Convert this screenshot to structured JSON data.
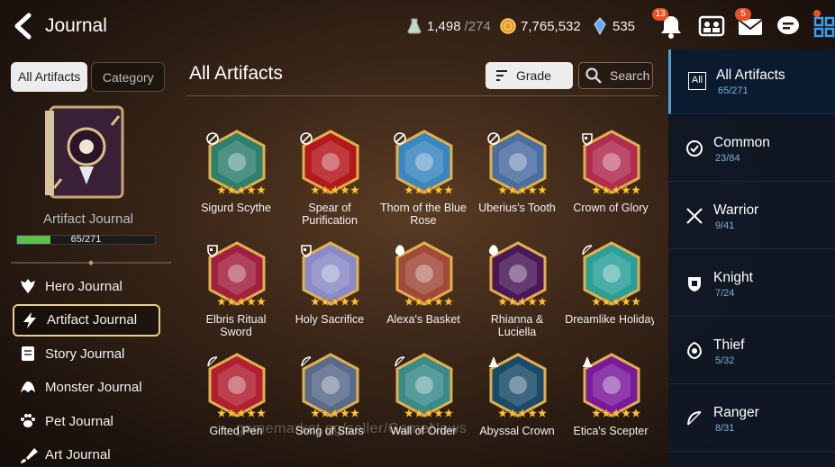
{
  "header": {
    "title": "Journal",
    "resources": [
      {
        "icon": "stamina-flask-icon",
        "value": "1,498",
        "sub": "/274"
      },
      {
        "icon": "gold-coin-icon",
        "value": "7,765,532",
        "sub": ""
      },
      {
        "icon": "skystone-gem-icon",
        "value": "535",
        "sub": ""
      }
    ],
    "notification_badge": "13",
    "mail_badge": "5"
  },
  "left_panel": {
    "tabs": [
      {
        "label": "All Artifacts",
        "active": true
      },
      {
        "label": "Category",
        "active": false
      }
    ],
    "journal_label": "Artifact Journal",
    "progress": {
      "text": "65/271",
      "fraction": 0.24
    },
    "nav": [
      {
        "label": "Hero Journal",
        "icon": "hero-icon",
        "active": false
      },
      {
        "label": "Artifact Journal",
        "icon": "lightning-icon",
        "active": true
      },
      {
        "label": "Story Journal",
        "icon": "scroll-icon",
        "active": false
      },
      {
        "label": "Monster Journal",
        "icon": "monster-icon",
        "active": false
      },
      {
        "label": "Pet Journal",
        "icon": "paw-icon",
        "active": false
      },
      {
        "label": "Art Journal",
        "icon": "brush-icon",
        "active": false
      }
    ]
  },
  "main": {
    "title": "All Artifacts",
    "grade_label": "Grade",
    "search_label": "Search",
    "artifacts": [
      {
        "name": "Sigurd Scythe",
        "class_icon": "warrior-icon",
        "color": "#2e7f6e"
      },
      {
        "name": "Spear of Purification",
        "class_icon": "warrior-icon",
        "color": "#b3181c"
      },
      {
        "name": "Thorn of the Blue Rose",
        "class_icon": "warrior-icon",
        "color": "#3a86c0"
      },
      {
        "name": "Uberius's Tooth",
        "class_icon": "warrior-icon",
        "color": "#4a6ea0"
      },
      {
        "name": "Crown of Glory",
        "class_icon": "knight-icon",
        "color": "#b02c50"
      },
      {
        "name": "Elbris Ritual Sword",
        "class_icon": "knight-icon",
        "color": "#a02040"
      },
      {
        "name": "Holy Sacrifice",
        "class_icon": "knight-icon",
        "color": "#8a8ac8"
      },
      {
        "name": "Alexa's Basket",
        "class_icon": "thief-icon",
        "color": "#a04a3a"
      },
      {
        "name": "Rhianna & Luciella",
        "class_icon": "thief-icon",
        "color": "#4a1858"
      },
      {
        "name": "Dreamlike Holiday",
        "class_icon": "ranger-icon",
        "color": "#2aa098"
      },
      {
        "name": "Gifted Pen",
        "class_icon": "ranger-icon",
        "color": "#b02030"
      },
      {
        "name": "Song of Stars",
        "class_icon": "ranger-icon",
        "color": "#5a6a8a"
      },
      {
        "name": "Wall of Order",
        "class_icon": "ranger-icon",
        "color": "#3a8a8a"
      },
      {
        "name": "Abyssal Crown",
        "class_icon": "mage-icon",
        "color": "#1a4a6a"
      },
      {
        "name": "Etica's Scepter",
        "class_icon": "mage-icon",
        "color": "#7a1a9a"
      }
    ],
    "watermark": "gamemarket.gg/seller/GameNews"
  },
  "right_panel": {
    "categories": [
      {
        "name": "All Artifacts",
        "count": "65/271",
        "icon": "all-icon",
        "active": true
      },
      {
        "name": "Common",
        "count": "23/84",
        "icon": "common-icon",
        "active": false
      },
      {
        "name": "Warrior",
        "count": "9/41",
        "icon": "warrior-icon",
        "active": false
      },
      {
        "name": "Knight",
        "count": "7/24",
        "icon": "knight-icon",
        "active": false
      },
      {
        "name": "Thief",
        "count": "5/32",
        "icon": "thief-icon",
        "active": false
      },
      {
        "name": "Ranger",
        "count": "8/31",
        "icon": "ranger-icon",
        "active": false
      }
    ],
    "all_box_label": "All"
  },
  "colors": {
    "accent_blue": "#4a9fd8",
    "gold_frame": "#e2b04a",
    "progress_green": "#5fbf46",
    "badge_orange": "#e7512a"
  }
}
